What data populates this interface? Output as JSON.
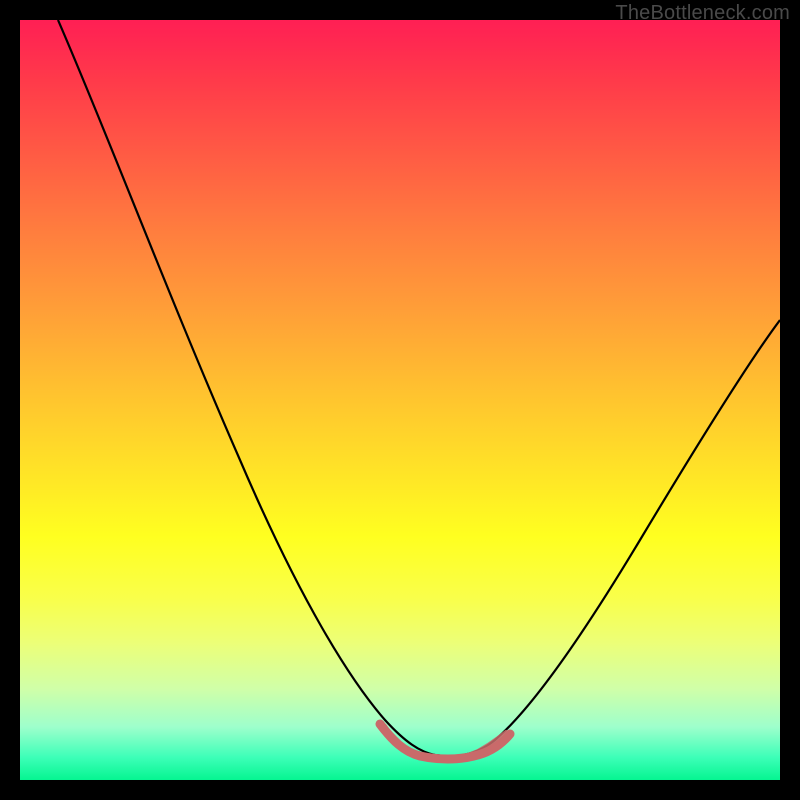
{
  "watermark": "TheBottleneck.com",
  "colors": {
    "curve_main": "#000000",
    "curve_accent": "#c96a6a",
    "gradient_top": "#ff1f54",
    "gradient_bottom": "#05f591",
    "frame": "#000000"
  },
  "chart_data": {
    "type": "line",
    "title": "",
    "xlabel": "",
    "ylabel": "",
    "xlim": [
      0,
      100
    ],
    "ylim": [
      0,
      100
    ],
    "series": [
      {
        "name": "bottleneck-curve",
        "x": [
          5,
          10,
          15,
          20,
          25,
          30,
          35,
          40,
          45,
          48,
          50,
          53,
          55,
          58,
          60,
          65,
          70,
          75,
          80,
          85,
          90,
          95,
          100
        ],
        "values": [
          100,
          87,
          75,
          63,
          51,
          40,
          30,
          21,
          13,
          8,
          5,
          3,
          2,
          2,
          3,
          5,
          10,
          17,
          25,
          33,
          42,
          51,
          60
        ]
      },
      {
        "name": "optimal-zone-highlight",
        "x": [
          48,
          50,
          52,
          54,
          56,
          58,
          60,
          62
        ],
        "values": [
          5,
          3,
          2,
          2,
          2,
          2,
          3,
          4
        ]
      }
    ],
    "annotations": []
  }
}
